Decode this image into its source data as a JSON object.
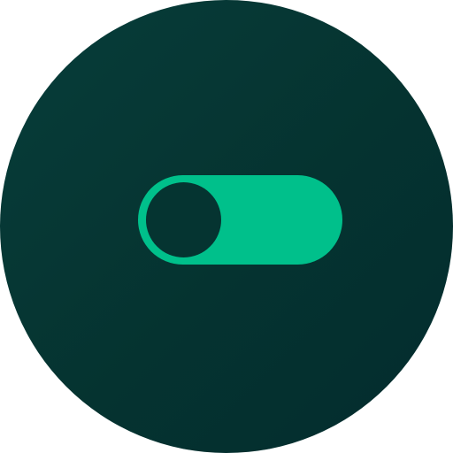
{
  "icon": {
    "name": "toggle-switch-icon",
    "background_color": "#053431",
    "accent_color": "#00c08b"
  },
  "toggle": {
    "state": "on",
    "track_color": "#00c08b",
    "knob_color": "#053431"
  }
}
